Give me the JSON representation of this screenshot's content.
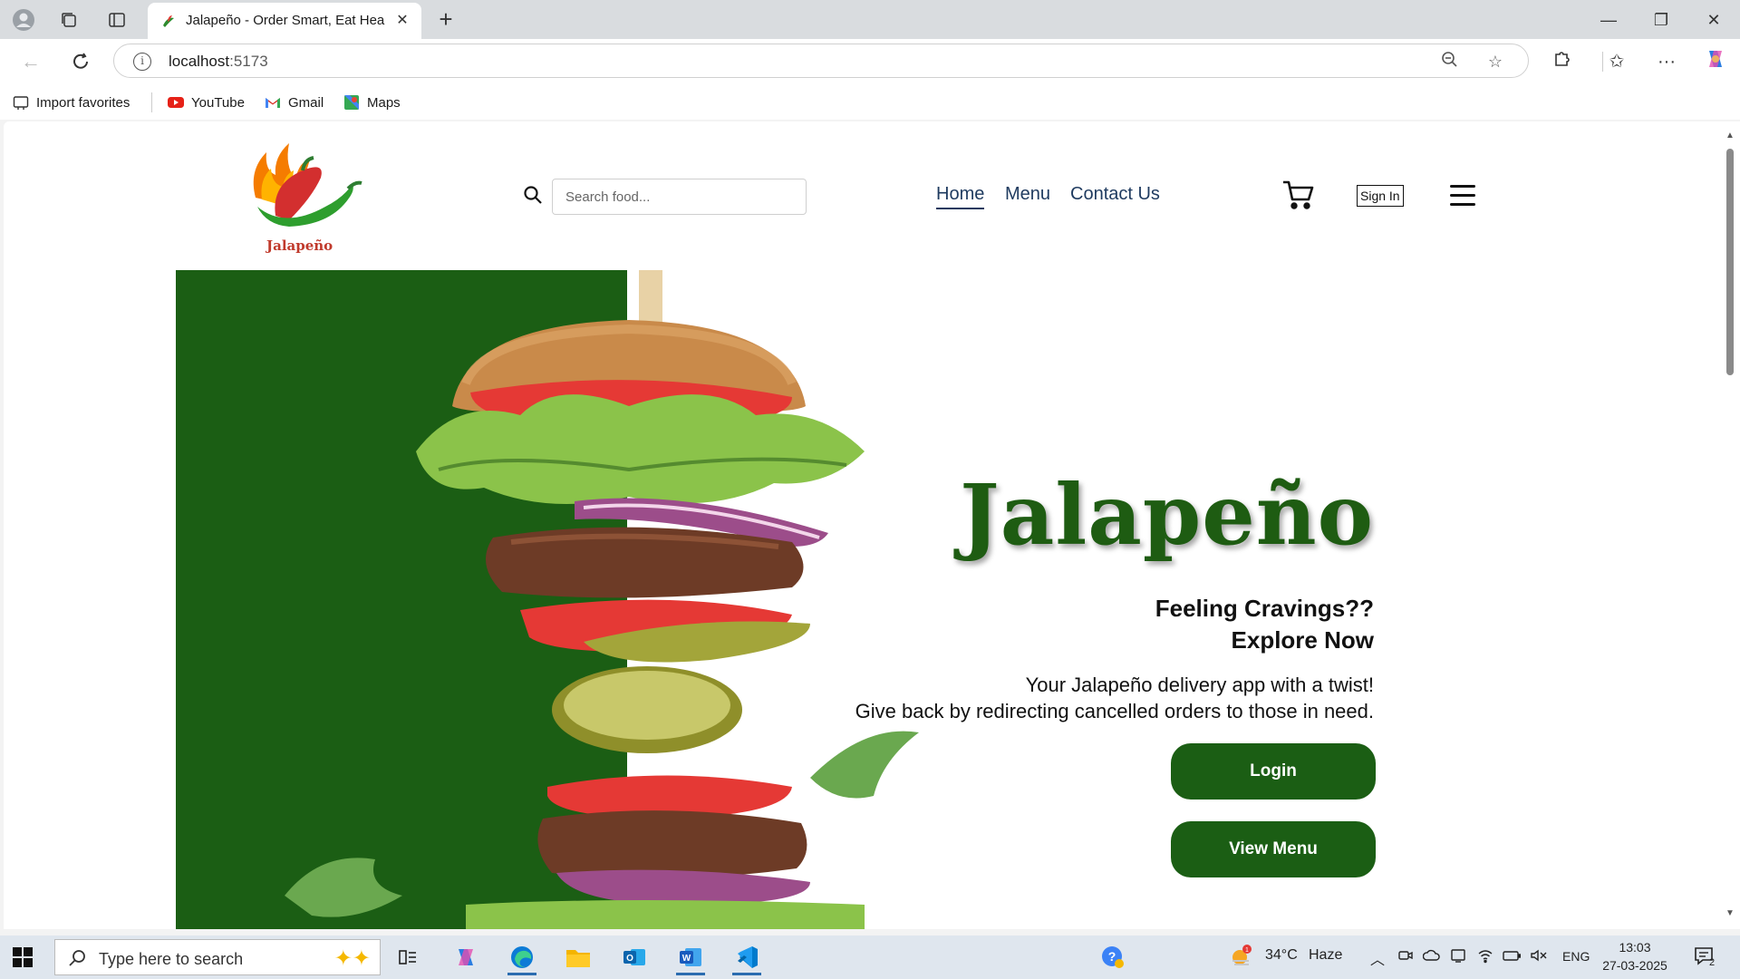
{
  "browser": {
    "tab_title": "Jalapeño - Order Smart, Eat Healthy",
    "url_host": "localhost",
    "url_port": ":5173",
    "favorites": [
      {
        "label": "Import favorites",
        "icon": "import-icon"
      },
      {
        "label": "YouTube",
        "icon": "youtube-icon"
      },
      {
        "label": "Gmail",
        "icon": "gmail-icon"
      },
      {
        "label": "Maps",
        "icon": "maps-icon"
      }
    ]
  },
  "site": {
    "logo_text": "Jalapeño",
    "search_placeholder": "Search food...",
    "nav": [
      {
        "label": "Home",
        "active": true
      },
      {
        "label": "Menu",
        "active": false
      },
      {
        "label": "Contact Us",
        "active": false
      }
    ],
    "signin_label": "Sign In",
    "hero": {
      "title": "Jalapeño",
      "subtitle_line1": "Feeling Cravings??",
      "subtitle_line2": "Explore Now",
      "desc_line1": "Your Jalapeño delivery app with a twist!",
      "desc_line2": "Give back by redirecting cancelled orders to those in need.",
      "login_label": "Login",
      "view_menu_label": "View Menu"
    },
    "colors": {
      "brand_green": "#1b5e14",
      "link": "#1e3a5f"
    }
  },
  "taskbar": {
    "search_placeholder": "Type here to search",
    "weather_temp": "34°C",
    "weather_desc": "Haze",
    "language": "ENG",
    "time": "13:03",
    "date": "27-03-2025",
    "notification_count": "2"
  }
}
